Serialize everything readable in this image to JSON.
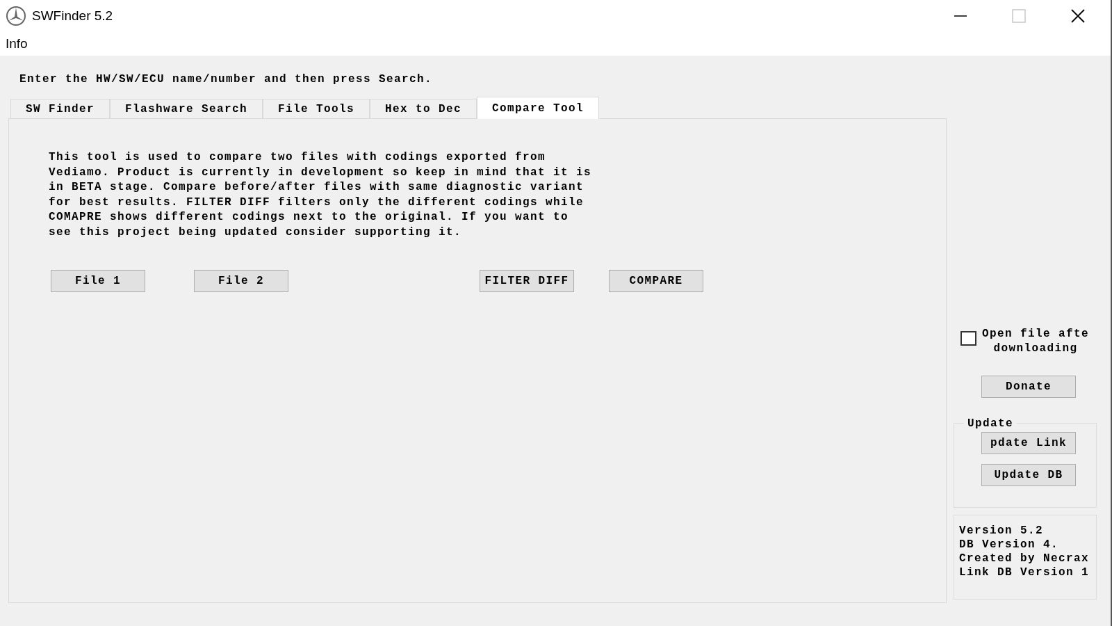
{
  "window": {
    "title": "SWFinder 5.2",
    "maximize_disabled": true
  },
  "menu": [
    {
      "label": "Info"
    }
  ],
  "instruction": "Enter the HW/SW/ECU name/number and then press Search.",
  "tabs": [
    {
      "label": "SW Finder",
      "selected": false
    },
    {
      "label": "Flashware Search",
      "selected": false
    },
    {
      "label": "File Tools",
      "selected": false
    },
    {
      "label": "Hex to Dec",
      "selected": false
    },
    {
      "label": "Compare Tool",
      "selected": true
    }
  ],
  "description": [
    "This tool is used to compare two files with codings exported from",
    "Vediamo. Product is currently in development so keep in mind that it is",
    "in BETA stage. Compare before/after files with same diagnostic variant",
    "for best results. FILTER DIFF filters only the different codings while",
    "COMAPRE shows different codings next to the original. If you want to",
    "see this project being updated consider supporting it."
  ],
  "buttons": [
    {
      "label": "File 1"
    },
    {
      "label": "File 2"
    },
    {
      "label": "FILTER DIFF"
    },
    {
      "label": "COMPARE"
    }
  ],
  "sidebar": {
    "checkbox": {
      "lines": [
        "Open file afte",
        "downloading"
      ],
      "checked": false
    },
    "donate": "Donate",
    "update_group": {
      "title": "Update",
      "buttons": [
        "pdate Link",
        "Update DB"
      ]
    },
    "version_info": [
      "Version 5.2",
      "DB Version 4.",
      "Created by Necrax",
      "Link DB Version 1"
    ]
  }
}
